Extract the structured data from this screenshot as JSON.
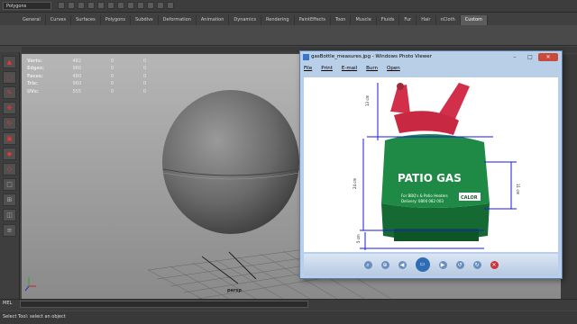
{
  "statusline": {
    "menuset": "Polygons"
  },
  "shelf_tabs": [
    "General",
    "Curves",
    "Surfaces",
    "Polygons",
    "Subdivs",
    "Deformation",
    "Animation",
    "Dynamics",
    "Rendering",
    "PaintEffects",
    "Toon",
    "Muscle",
    "Fluids",
    "Fur",
    "Hair",
    "nCloth",
    "Custom"
  ],
  "active_tab": "Custom",
  "hud": [
    {
      "label": "Verts:",
      "a": "482",
      "b": "0",
      "c": "0"
    },
    {
      "label": "Edges:",
      "a": "960",
      "b": "0",
      "c": "0"
    },
    {
      "label": "Faces:",
      "a": "480",
      "b": "0",
      "c": "0"
    },
    {
      "label": "Tris:",
      "a": "960",
      "b": "0",
      "c": "0"
    },
    {
      "label": "UVs:",
      "a": "555",
      "b": "0",
      "c": "0"
    }
  ],
  "viewport": {
    "camera_label": "persp"
  },
  "photo_viewer": {
    "title": "gasBottle_measures.jpg - Windows Photo Viewer",
    "menu": [
      "File",
      "Print",
      "E-mail",
      "Burn",
      "Open"
    ],
    "image": {
      "brand": "PATIO GAS",
      "small_text_1": "For BBQ's & Patio Heaters",
      "small_text_2": "Delivery: 0800 082 003",
      "logo": "CALOR",
      "measure_top": "13 cm",
      "measure_body": "24 cm",
      "measure_right": "11 cm",
      "measure_base": "5 cm"
    }
  },
  "commandline": {
    "label": "MEL"
  },
  "helpline": {
    "text": "Select Tool: select an object"
  }
}
